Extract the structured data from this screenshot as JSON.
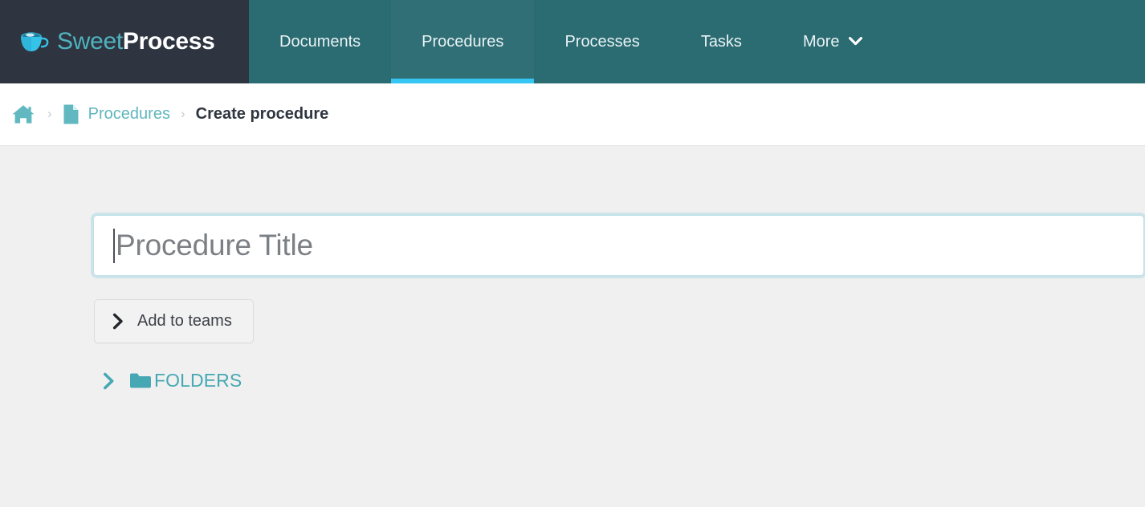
{
  "brand": {
    "name_light": "Sweet",
    "name_bold": "Process",
    "logo_icon": "coffee-cup-icon"
  },
  "nav": {
    "items": [
      {
        "label": "Documents",
        "active": false,
        "has_caret": false
      },
      {
        "label": "Procedures",
        "active": true,
        "has_caret": false
      },
      {
        "label": "Processes",
        "active": false,
        "has_caret": false
      },
      {
        "label": "Tasks",
        "active": false,
        "has_caret": false
      },
      {
        "label": "More",
        "active": false,
        "has_caret": true,
        "caret_icon": "chevron-down-icon"
      }
    ]
  },
  "breadcrumb": {
    "home_icon": "home-icon",
    "separator": "›",
    "doc_icon": "document-icon",
    "link_label": "Procedures",
    "current_label": "Create procedure"
  },
  "main": {
    "title_input": {
      "value": "",
      "placeholder": "Procedure Title",
      "focused": true
    },
    "add_to_teams": {
      "label": "Add to teams",
      "chevron_icon": "chevron-right-icon",
      "expanded": false
    },
    "folders": {
      "label": "FOLDERS",
      "chevron_icon": "chevron-right-icon",
      "folder_icon": "folder-icon",
      "expanded": false
    }
  },
  "colors": {
    "brand_dark": "#2e3540",
    "nav_teal": "#2b6b72",
    "nav_active_bg": "#306f76",
    "active_underline": "#36c6f4",
    "accent_teal": "#5fb6bd",
    "folders_teal": "#46a8b3",
    "page_bg": "#f0f0f1",
    "breadcrumb_bg": "#ffffff",
    "input_border": "#bfe0e6"
  }
}
